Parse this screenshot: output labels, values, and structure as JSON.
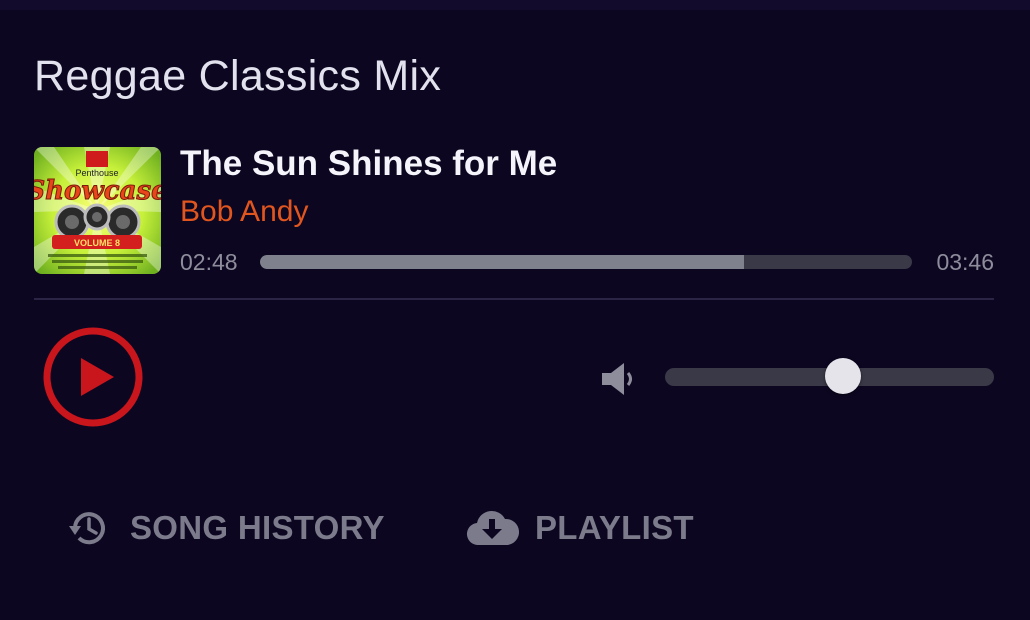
{
  "playlist": {
    "title": "Reggae Classics Mix"
  },
  "now_playing": {
    "title": "The Sun Shines for Me",
    "artist": "Bob Andy",
    "elapsed": "02:48",
    "duration": "03:46",
    "progress_fraction": 0.743,
    "album_art": {
      "top_text": "Penthouse",
      "main_text": "Showcase",
      "sub_text": "VOLUME 8"
    }
  },
  "controls": {
    "play_icon": "play-circle-icon",
    "volume_icon": "volume-icon",
    "volume_fraction": 0.54
  },
  "bottom_buttons": {
    "history_label": "SONG HISTORY",
    "history_icon": "history-icon",
    "playlist_label": "PLAYLIST",
    "playlist_icon": "cloud-download-icon"
  },
  "colors": {
    "background": "#0d0621",
    "accent_play": "#c8161c",
    "artist": "#e0561e",
    "muted": "#7c7b8c"
  }
}
